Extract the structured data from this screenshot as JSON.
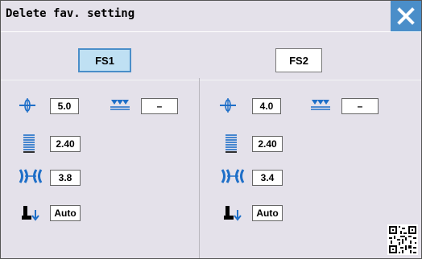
{
  "window": {
    "title": "Delete fav. setting"
  },
  "buttons": {
    "fs1": "FS1",
    "fs2": "FS2"
  },
  "fs1": {
    "stitch_width": "5.0",
    "stitch_length": "2.40",
    "thread_tension": "3.8",
    "presser_foot": "Auto",
    "feed_setting": "–"
  },
  "fs2": {
    "stitch_width": "4.0",
    "stitch_length": "2.40",
    "thread_tension": "3.4",
    "presser_foot": "Auto",
    "feed_setting": "–"
  },
  "colors": {
    "accent": "#4a8ec9",
    "selected": "#bfe0f3",
    "background": "#e4e1ea"
  },
  "icons": [
    "close-icon",
    "stitch-width-icon",
    "feed-icon",
    "stitch-length-icon",
    "tension-icon",
    "presser-foot-icon",
    "qr-code-icon"
  ]
}
